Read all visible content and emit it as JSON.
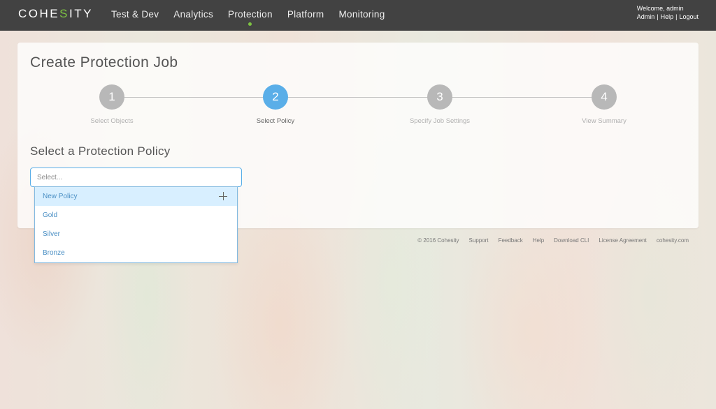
{
  "app": {
    "logo": {
      "pre": "COHE",
      "s": "S",
      "post": "ITY"
    }
  },
  "nav": {
    "items": [
      {
        "label": "Test & Dev"
      },
      {
        "label": "Analytics"
      },
      {
        "label": "Protection",
        "active": true
      },
      {
        "label": "Platform"
      },
      {
        "label": "Monitoring"
      }
    ],
    "active_indicator_color": "#7dc242"
  },
  "user": {
    "welcome": "Welcome, admin",
    "links": [
      "Admin",
      "Help",
      "Logout"
    ],
    "separator": "|"
  },
  "page": {
    "title": "Create Protection Job",
    "steps": [
      {
        "number": "1",
        "label": "Select Objects"
      },
      {
        "number": "2",
        "label": "Select Policy",
        "active": true
      },
      {
        "number": "3",
        "label": "Specify Job Settings"
      },
      {
        "number": "4",
        "label": "View Summary"
      }
    ],
    "section_title": "Select a Protection Policy",
    "policy_select": {
      "placeholder": "Select...",
      "options": [
        {
          "label": "New Policy",
          "icon": "plus-icon",
          "highlighted": true
        },
        {
          "label": "Gold"
        },
        {
          "label": "Silver"
        },
        {
          "label": "Bronze"
        }
      ]
    }
  },
  "footer": {
    "copyright": "© 2016 Cohesity",
    "links": [
      "Support",
      "Feedback",
      "Help",
      "Download CLI",
      "License Agreement",
      "cohesity.com"
    ]
  },
  "colors": {
    "topbar": "#424242",
    "accent_blue": "#5aaee8",
    "step_inactive": "#b8b8b8",
    "dropdown_highlight": "#d8efff",
    "link_blue": "#4a8fc4"
  }
}
